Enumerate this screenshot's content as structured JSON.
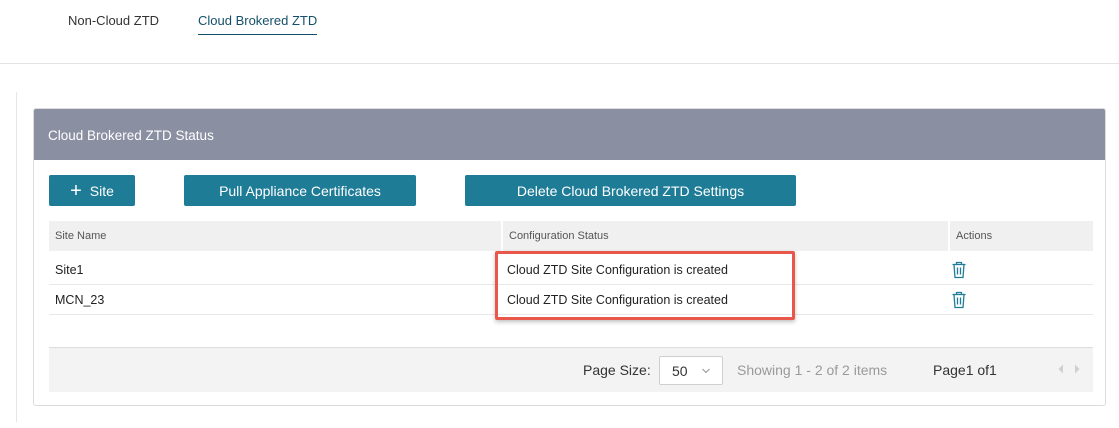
{
  "tabs": [
    {
      "label": "Non-Cloud ZTD",
      "active": false
    },
    {
      "label": "Cloud Brokered ZTD",
      "active": true
    }
  ],
  "panel": {
    "title": "Cloud Brokered ZTD Status",
    "buttons": {
      "add_site": {
        "icon": "plus-icon",
        "label": "Site"
      },
      "pull_certificates": "Pull Appliance Certificates",
      "delete_settings": "Delete Cloud Brokered ZTD Settings"
    }
  },
  "table": {
    "columns": [
      "Site Name",
      "Configuration Status",
      "Actions"
    ],
    "rows": [
      {
        "site_name": "Site1",
        "status": "Cloud ZTD Site Configuration is created",
        "action_icon": "trash-icon"
      },
      {
        "site_name": "MCN_23",
        "status": "Cloud ZTD Site Configuration is created",
        "action_icon": "trash-icon"
      }
    ]
  },
  "pagination": {
    "page_size_label": "Page Size:",
    "page_size": "50",
    "showing": "Showing 1 - 2 of 2 items",
    "page": "Page1 of1"
  },
  "colors": {
    "accent": "#1e7c97",
    "header_bg": "#8a8fa1",
    "active_tab": "#14506a",
    "highlight": "#e8574a"
  }
}
